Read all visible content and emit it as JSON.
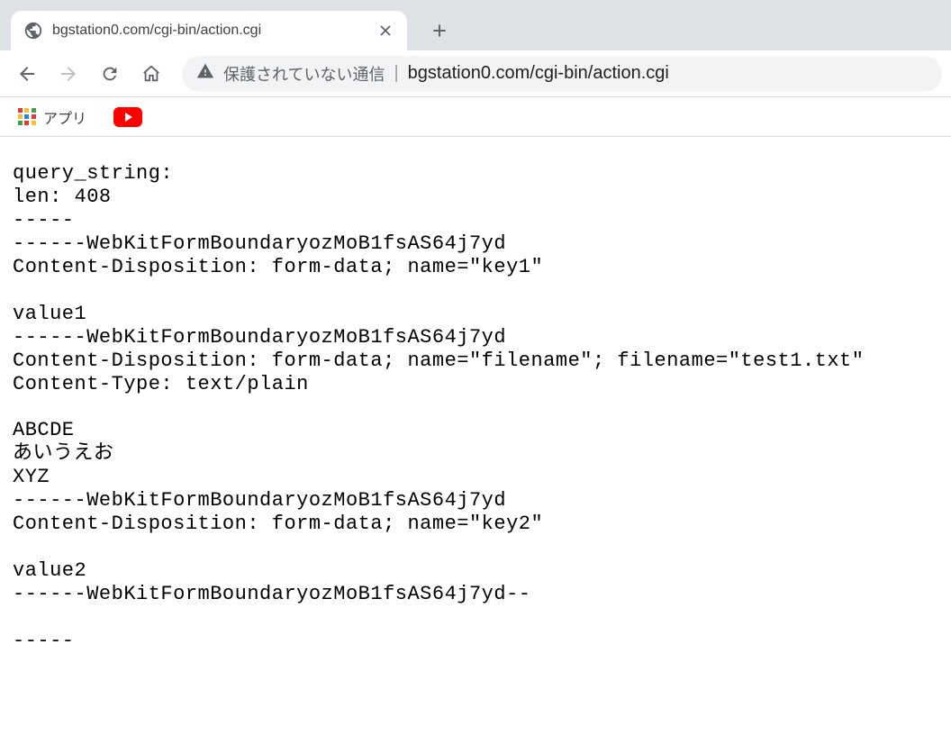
{
  "tab": {
    "title": "bgstation0.com/cgi-bin/action.cgi"
  },
  "omnibox": {
    "warning_text": "保護されていない通信",
    "url": "bgstation0.com/cgi-bin/action.cgi"
  },
  "bookmarks": {
    "apps_label": "アプリ"
  },
  "body_text": "query_string:\nlen: 408\n-----\n------WebKitFormBoundaryozMoB1fsAS64j7yd\nContent-Disposition: form-data; name=\"key1\"\n\nvalue1\n------WebKitFormBoundaryozMoB1fsAS64j7yd\nContent-Disposition: form-data; name=\"filename\"; filename=\"test1.txt\"\nContent-Type: text/plain\n\nABCDE\nあいうえお\nXYZ\n------WebKitFormBoundaryozMoB1fsAS64j7yd\nContent-Disposition: form-data; name=\"key2\"\n\nvalue2\n------WebKitFormBoundaryozMoB1fsAS64j7yd--\n\n-----"
}
